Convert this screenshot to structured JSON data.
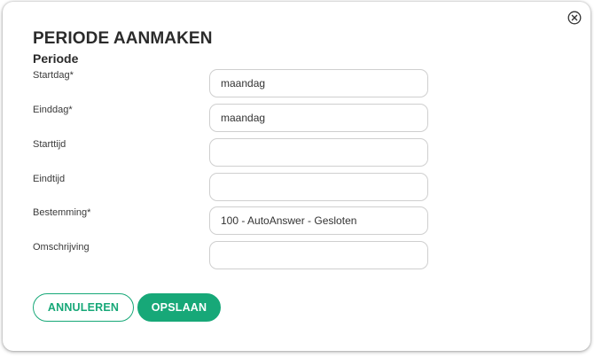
{
  "dialog": {
    "title": "PERIODE AANMAKEN",
    "section_title": "Periode",
    "close_icon": "close-circle-icon"
  },
  "fields": [
    {
      "label": "Startdag*",
      "value": "maandag"
    },
    {
      "label": "Einddag*",
      "value": "maandag"
    },
    {
      "label": "Starttijd",
      "value": ""
    },
    {
      "label": "Eindtijd",
      "value": ""
    },
    {
      "label": "Bestemming*",
      "value": "100 - AutoAnswer - Gesloten"
    },
    {
      "label": "Omschrijving",
      "value": ""
    }
  ],
  "buttons": {
    "cancel_label": "ANNULEREN",
    "save_label": "OPSLAAN"
  },
  "colors": {
    "accent": "#17a878",
    "text": "#2b2b2b",
    "border": "#cfcfcf"
  }
}
